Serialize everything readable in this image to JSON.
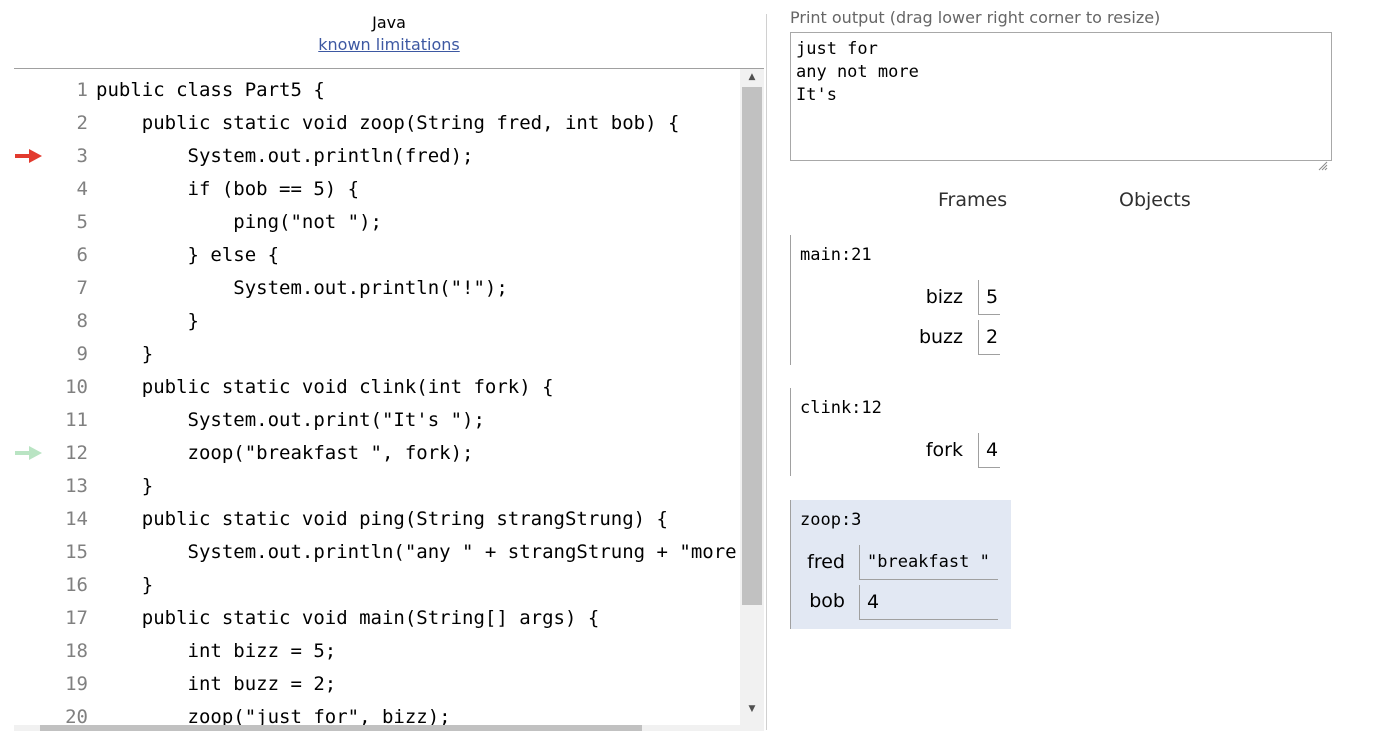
{
  "editor": {
    "language": "Java",
    "limitations_link": "known limitations",
    "lines": [
      {
        "num": "1",
        "code": "public class Part5 {",
        "arrow": ""
      },
      {
        "num": "2",
        "code": "    public static void zoop(String fred, int bob) {",
        "arrow": ""
      },
      {
        "num": "3",
        "code": "        System.out.println(fred);",
        "arrow": "current"
      },
      {
        "num": "4",
        "code": "        if (bob == 5) {",
        "arrow": ""
      },
      {
        "num": "5",
        "code": "            ping(\"not \");",
        "arrow": ""
      },
      {
        "num": "6",
        "code": "        } else {",
        "arrow": ""
      },
      {
        "num": "7",
        "code": "            System.out.println(\"!\");",
        "arrow": ""
      },
      {
        "num": "8",
        "code": "        }",
        "arrow": ""
      },
      {
        "num": "9",
        "code": "    }",
        "arrow": ""
      },
      {
        "num": "10",
        "code": "    public static void clink(int fork) {",
        "arrow": ""
      },
      {
        "num": "11",
        "code": "        System.out.print(\"It's \");",
        "arrow": ""
      },
      {
        "num": "12",
        "code": "        zoop(\"breakfast \", fork);",
        "arrow": "previous"
      },
      {
        "num": "13",
        "code": "    }",
        "arrow": ""
      },
      {
        "num": "14",
        "code": "    public static void ping(String strangStrung) {",
        "arrow": ""
      },
      {
        "num": "15",
        "code": "        System.out.println(\"any \" + strangStrung + \"more\");",
        "arrow": ""
      },
      {
        "num": "16",
        "code": "    }",
        "arrow": ""
      },
      {
        "num": "17",
        "code": "    public static void main(String[] args) {",
        "arrow": ""
      },
      {
        "num": "18",
        "code": "        int bizz = 5;",
        "arrow": ""
      },
      {
        "num": "19",
        "code": "        int buzz = 2;",
        "arrow": ""
      },
      {
        "num": "20",
        "code": "        zoop(\"just for\", bizz);",
        "arrow": ""
      }
    ]
  },
  "colors": {
    "current_arrow": "#e23a2e",
    "previous_arrow": "#b9e4c3",
    "active_frame_bg": "#e2e8f3",
    "link": "#3d58a2"
  },
  "output": {
    "label": "Print output (drag lower right corner to resize)",
    "text": "just for\nany not more\nIt's"
  },
  "visualizer": {
    "frames_tab": "Frames",
    "objects_tab": "Objects",
    "frames": [
      {
        "title": "main:21",
        "vars": [
          {
            "name": "bizz",
            "value": "5"
          },
          {
            "name": "buzz",
            "value": "2"
          }
        ]
      },
      {
        "title": "clink:12",
        "vars": [
          {
            "name": "fork",
            "value": "4"
          }
        ]
      },
      {
        "title": "zoop:3",
        "vars": [
          {
            "name": "fred",
            "value": "\"breakfast \""
          },
          {
            "name": "bob",
            "value": "4"
          }
        ]
      }
    ]
  }
}
